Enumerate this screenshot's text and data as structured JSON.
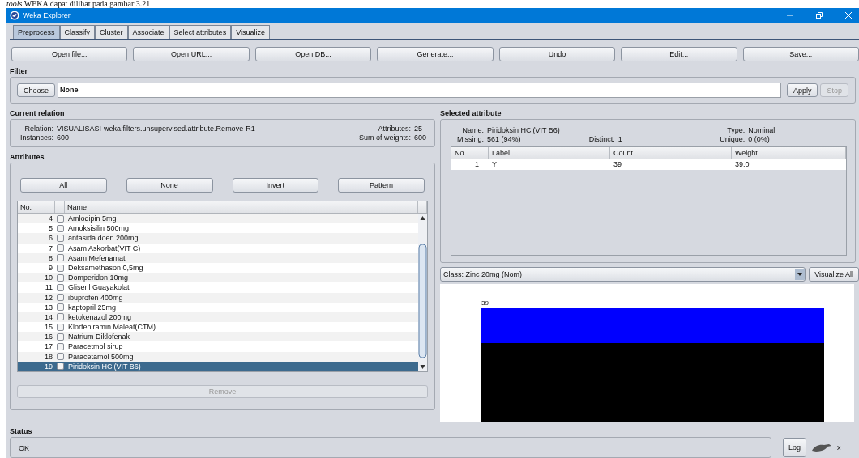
{
  "caption": {
    "text": "*tools* WEKA dapat dilihat pada gambar 3.21"
  },
  "window": {
    "title": "Weka Explorer"
  },
  "tabs": [
    {
      "label": "Preprocess",
      "selected": true
    },
    {
      "label": "Classify",
      "selected": false
    },
    {
      "label": "Cluster",
      "selected": false
    },
    {
      "label": "Associate",
      "selected": false
    },
    {
      "label": "Select attributes",
      "selected": false
    },
    {
      "label": "Visualize",
      "selected": false
    }
  ],
  "toolbar": [
    "Open file...",
    "Open URL...",
    "Open DB...",
    "Generate...",
    "Undo",
    "Edit...",
    "Save..."
  ],
  "filter": {
    "heading": "Filter",
    "choose": "Choose",
    "value": "None",
    "apply": {
      "label": "Apply",
      "disabled": false
    },
    "stop": {
      "label": "Stop",
      "disabled": true
    }
  },
  "current_relation": {
    "heading": "Current relation",
    "relation_label": "Relation:",
    "relation": "VISUALISASI-weka.filters.unsupervised.attribute.Remove-R1",
    "instances_label": "Instances:",
    "instances": "600",
    "attributes_label": "Attributes:",
    "attributes": "25",
    "weights_label": "Sum of weights:",
    "weights": "600"
  },
  "attributes": {
    "heading": "Attributes",
    "buttons": [
      "All",
      "None",
      "Invert",
      "Pattern"
    ],
    "columns": [
      "No.",
      "Name"
    ],
    "rows": [
      {
        "no": "4",
        "name": "Amlodipin 5mg",
        "checked": false,
        "selected": false
      },
      {
        "no": "5",
        "name": "Amoksisilin 500mg",
        "checked": false,
        "selected": false
      },
      {
        "no": "6",
        "name": "antasida doen 200mg",
        "checked": false,
        "selected": false
      },
      {
        "no": "7",
        "name": "Asam Askorbat(VIT C)",
        "checked": false,
        "selected": false
      },
      {
        "no": "8",
        "name": "Asam Mefenamat",
        "checked": false,
        "selected": false
      },
      {
        "no": "9",
        "name": "Deksamethason 0,5mg",
        "checked": false,
        "selected": false
      },
      {
        "no": "10",
        "name": "Domperidon 10mg",
        "checked": false,
        "selected": false
      },
      {
        "no": "11",
        "name": "Gliseril Guayakolat",
        "checked": false,
        "selected": false
      },
      {
        "no": "12",
        "name": "ibuprofen 400mg",
        "checked": false,
        "selected": false
      },
      {
        "no": "13",
        "name": "kaptopril 25mg",
        "checked": false,
        "selected": false
      },
      {
        "no": "14",
        "name": "ketokenazol 200mg",
        "checked": false,
        "selected": false
      },
      {
        "no": "15",
        "name": "Klorfeniramin Maleat(CTM)",
        "checked": false,
        "selected": false
      },
      {
        "no": "16",
        "name": "Natrium Diklofenak",
        "checked": false,
        "selected": false
      },
      {
        "no": "17",
        "name": "Paracetmol sirup",
        "checked": false,
        "selected": false
      },
      {
        "no": "18",
        "name": "Paracetamol 500mg",
        "checked": false,
        "selected": false
      },
      {
        "no": "19",
        "name": "Piridoksin HCl(VIT B6)",
        "checked": false,
        "selected": true
      }
    ],
    "remove": {
      "label": "Remove",
      "disabled": true
    }
  },
  "selected_attribute": {
    "heading": "Selected attribute",
    "name_label": "Name:",
    "name": "Piridoksin HCl(VIT B6)",
    "type_label": "Type:",
    "type": "Nominal",
    "missing_label": "Missing:",
    "missing": "561 (94%)",
    "distinct_label": "Distinct:",
    "distinct": "1",
    "unique_label": "Unique:",
    "unique": "0 (0%)",
    "columns": [
      "No.",
      "Label",
      "Count",
      "Weight"
    ],
    "rows": [
      [
        "1",
        "Y",
        "39",
        "39.0"
      ]
    ]
  },
  "class_select": {
    "value": "Class: Zinc 20mg (Nom)"
  },
  "visualize_all": "Visualize All",
  "histogram": {
    "bar_label": "39"
  },
  "status": {
    "heading": "Status",
    "message": "OK",
    "log": "Log",
    "count": "x"
  }
}
